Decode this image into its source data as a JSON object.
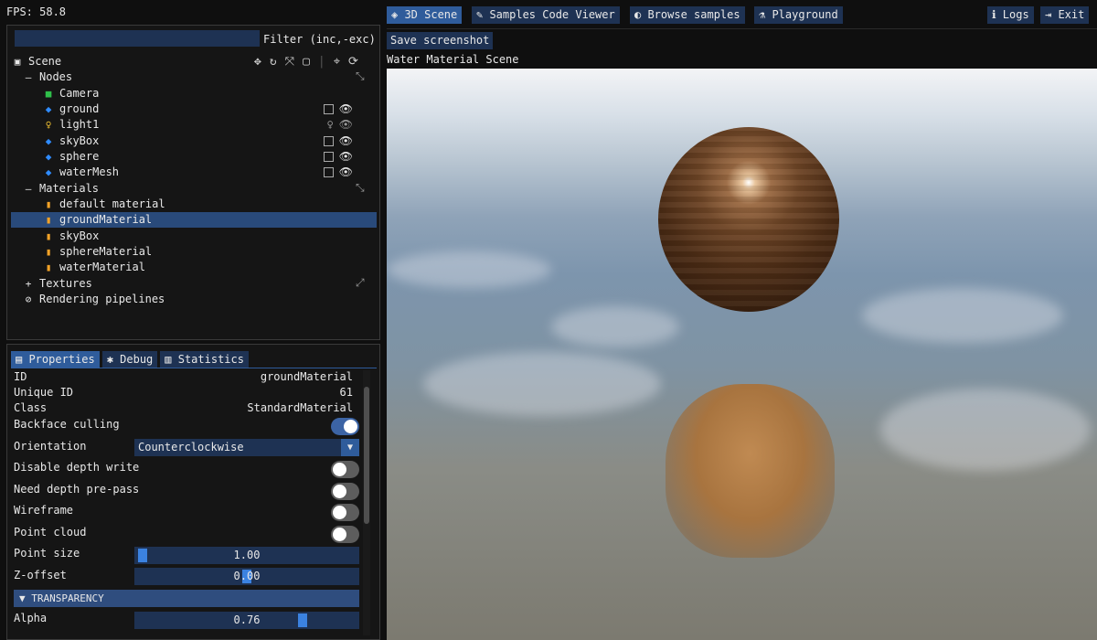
{
  "fps_label": "FPS: 58.8",
  "filter": {
    "value": "",
    "label": "Filter (inc,-exc)"
  },
  "tree": {
    "scene": "Scene",
    "nodes": "Nodes",
    "node_items": [
      "Camera",
      "ground",
      "light1",
      "skyBox",
      "sphere",
      "waterMesh"
    ],
    "materials": "Materials",
    "material_items": [
      "default material",
      "groundMaterial",
      "skyBox",
      "sphereMaterial",
      "waterMaterial"
    ],
    "textures": "Textures",
    "pipelines": "Rendering pipelines"
  },
  "tabs": [
    "Properties",
    "Debug",
    "Statistics"
  ],
  "properties": {
    "id_label": "ID",
    "id_value": "groundMaterial",
    "uid_label": "Unique ID",
    "uid_value": "61",
    "class_label": "Class",
    "class_value": "StandardMaterial",
    "backface_label": "Backface culling",
    "backface_on": true,
    "orientation_label": "Orientation",
    "orientation_value": "Counterclockwise",
    "depth_write_label": "Disable depth write",
    "depth_prepass_label": "Need depth pre-pass",
    "wireframe_label": "Wireframe",
    "point_cloud_label": "Point cloud",
    "point_size_label": "Point size",
    "point_size_value": "1.00",
    "zoffset_label": "Z-offset",
    "zoffset_value": "0.00",
    "transparency_label": "TRANSPARENCY",
    "alpha_label": "Alpha",
    "alpha_value": "0.76"
  },
  "topbar": {
    "scene": "3D Scene",
    "code": "Samples Code Viewer",
    "browse": "Browse samples",
    "playground": "Playground",
    "logs": "Logs",
    "exit": "Exit"
  },
  "save_screenshot": "Save screenshot",
  "scene_title": "Water Material Scene",
  "colors": {
    "accent": "#2f5c9b",
    "button_bg": "#1e3253",
    "selected_row": "#294a7a"
  }
}
